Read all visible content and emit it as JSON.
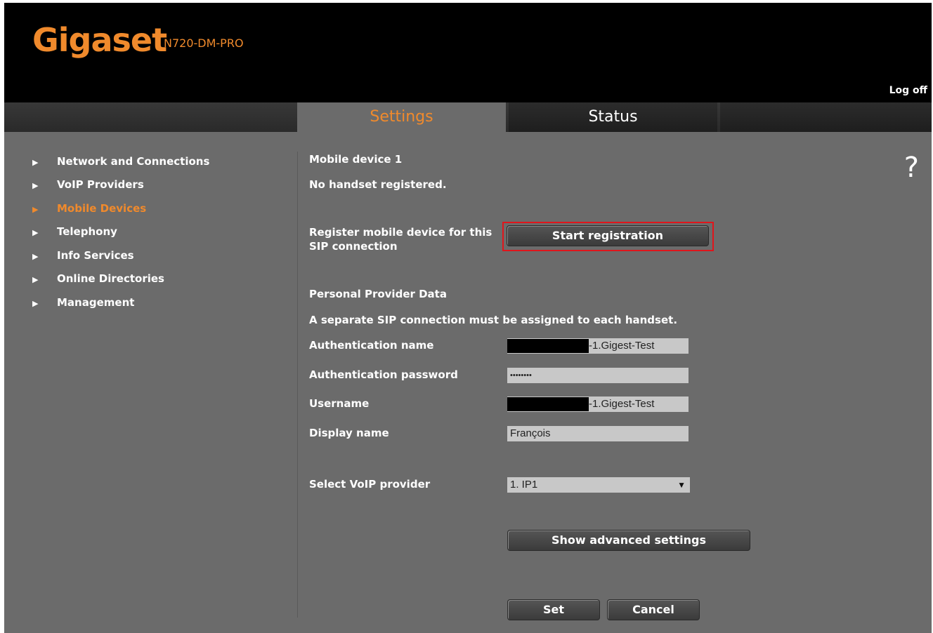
{
  "header": {
    "brand": "Gigaset",
    "model": "N720-DM-PRO",
    "logoff": "Log off"
  },
  "tabs": [
    {
      "label": "Settings",
      "active": true
    },
    {
      "label": "Status",
      "active": false
    }
  ],
  "sidebar": {
    "items": [
      {
        "label": "Network and Connections",
        "active": false
      },
      {
        "label": "VoIP Providers",
        "active": false
      },
      {
        "label": "Mobile Devices",
        "active": true
      },
      {
        "label": "Telephony",
        "active": false
      },
      {
        "label": "Info Services",
        "active": false
      },
      {
        "label": "Online Directories",
        "active": false
      },
      {
        "label": "Management",
        "active": false
      }
    ]
  },
  "help_icon": "?",
  "main": {
    "device_title": "Mobile device 1",
    "device_status": "No handset registered.",
    "register_label_line1": "Register mobile device for this",
    "register_label_line2": "SIP connection",
    "register_button": "Start registration",
    "provider_heading": "Personal Provider Data",
    "provider_note": "A separate SIP connection must be assigned to each handset.",
    "fields": {
      "auth_name": {
        "label": "Authentication name",
        "value_suffix": "-1.Gigest-Test"
      },
      "auth_password": {
        "label": "Authentication password",
        "value": "••••••••"
      },
      "username": {
        "label": "Username",
        "value_suffix": "-1.Gigest-Test"
      },
      "display_name": {
        "label": "Display name",
        "value": "François"
      }
    },
    "voip_select": {
      "label": "Select VoIP provider",
      "value": "1. IP1"
    },
    "advanced_button": "Show advanced settings",
    "set_button": "Set",
    "cancel_button": "Cancel"
  },
  "colors": {
    "accent": "#f08a2c",
    "background": "#6b6b6b",
    "header": "#000000",
    "highlight": "#e0151b"
  }
}
